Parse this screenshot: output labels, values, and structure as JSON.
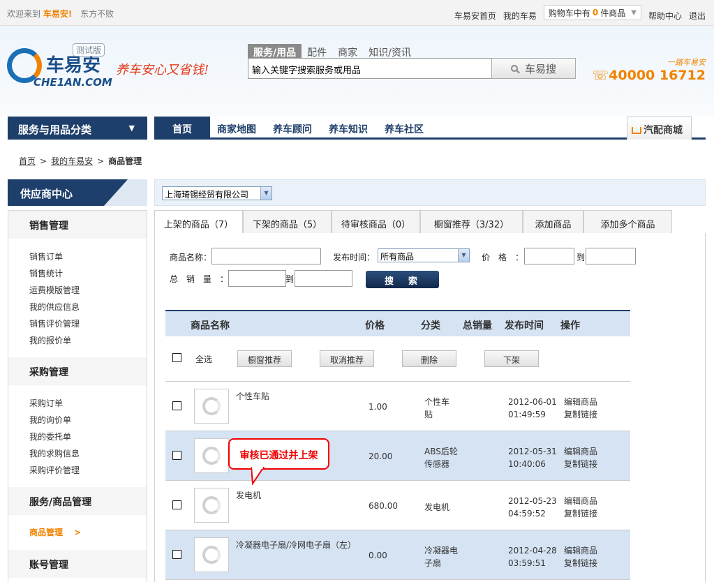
{
  "topbar": {
    "welcome": "欢迎来到",
    "brand": "车易安!",
    "user": "东方不败",
    "links": [
      "车易安首页",
      "我的车易"
    ],
    "cart_prefix": "购物车中有",
    "cart_count": "0",
    "cart_suffix": "件商品",
    "help": "帮助中心",
    "logout": "退出"
  },
  "header": {
    "logo_name": "车易安",
    "logo_url": "CHE1AN.COM",
    "test_badge": "测试版",
    "slogan": "养车安心又省钱!",
    "search_tabs": [
      "服务/用品",
      "配件",
      "商家",
      "知识/资讯"
    ],
    "search_value": "输入关键字搜索服务或用品",
    "search_button": "车易搜",
    "hotline_tag": "一路车易安",
    "hotline_number": "40000 16712"
  },
  "nav": {
    "category": "服务与用品分类",
    "items": [
      "首页",
      "商家地图",
      "养车顾问",
      "养车知识",
      "养车社区"
    ],
    "mall": "汽配商城"
  },
  "breadcrumb": {
    "home": "首页",
    "mine": "我的车易安",
    "current": "商品管理"
  },
  "sidebar": {
    "title": "供应商中心",
    "groups": [
      {
        "title": "销售管理",
        "items": [
          "销售订单",
          "销售统计",
          "运费模版管理",
          "我的供应信息",
          "销售评价管理",
          "我的报价单"
        ]
      },
      {
        "title": "采购管理",
        "items": [
          "采购订单",
          "我的询价单",
          "我的委托单",
          "我的求购信息",
          "采购评价管理"
        ]
      },
      {
        "title": "服务/商品管理",
        "items": [
          "商品管理"
        ]
      },
      {
        "title": "账号管理",
        "items": []
      }
    ]
  },
  "company": "上海琦锡经贸有限公司",
  "tabs": [
    "上架的商品（7）",
    "下架的商品（5）",
    "待审核商品（0）",
    "橱窗推荐（3/32）",
    "添加商品",
    "添加多个商品"
  ],
  "filters": {
    "name_label": "商品名称：",
    "time_label": "发布时间：",
    "time_value": "所有商品",
    "price_label": "价　格　：",
    "to": "到",
    "sales_label": "总　销　量　：",
    "search": "搜　索"
  },
  "table": {
    "headers": [
      "商品名称",
      "价格",
      "分类",
      "总销量",
      "发布时间",
      "操作"
    ],
    "select_all": "全选",
    "actions": [
      "橱窗推荐",
      "取消推荐",
      "删除",
      "下架"
    ],
    "rows": [
      {
        "name": "个性车贴",
        "price": "1.00",
        "cat1": "个性车",
        "cat2": "贴",
        "date": "2012-06-01",
        "time": "01:49:59",
        "op1": "编辑商品",
        "op2": "复制链接"
      },
      {
        "name": "",
        "price": "20.00",
        "cat1": "ABS后轮",
        "cat2": "传感器",
        "date": "2012-05-31",
        "time": "10:40:06",
        "op1": "编辑商品",
        "op2": "复制链接"
      },
      {
        "name": "发电机",
        "price": "680.00",
        "cat1": "发电机",
        "cat2": "",
        "date": "2012-05-23",
        "time": "04:59:52",
        "op1": "编辑商品",
        "op2": "复制链接"
      },
      {
        "name": "冷凝器电子扇/冷网电子扇（左）",
        "price": "0.00",
        "cat1": "冷凝器电",
        "cat2": "子扇",
        "date": "2012-04-28",
        "time": "03:59:51",
        "op1": "编辑商品",
        "op2": "复制链接"
      }
    ]
  },
  "callout": "审核已通过并上架",
  "colors": {
    "brand_orange": "#f08300",
    "nav_blue": "#1e3f6b",
    "row_alt": "#d5e3f3",
    "callout_red": "#e00000"
  },
  "icons": [
    "e-logo-icon",
    "search-icon",
    "phone-icon",
    "cart-icon",
    "chevron-down-icon",
    "chevron-right-icon",
    "product-placeholder-icon"
  ]
}
